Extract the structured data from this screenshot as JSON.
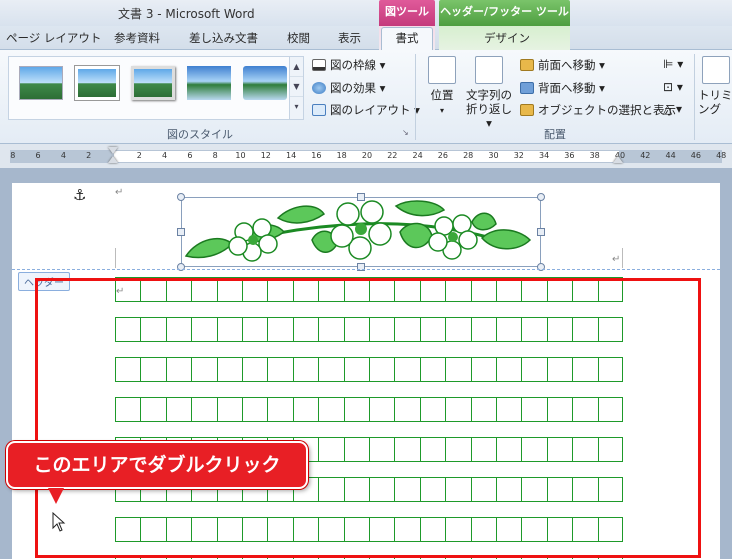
{
  "window": {
    "title": "文書 3 - Microsoft Word"
  },
  "context_tabs": {
    "picture_tools": "図ツール",
    "header_footer_tools": "ヘッダー/フッター ツール"
  },
  "tabs": {
    "page_layout": "ページ レイアウト",
    "references": "参考資料",
    "mailings": "差し込み文書",
    "review": "校閲",
    "view": "表示",
    "format": "書式",
    "design": "デザイン"
  },
  "ribbon": {
    "picture_styles": {
      "label": "図のスタイル",
      "border": "図の枠線",
      "effects": "図の効果",
      "layout": "図のレイアウト"
    },
    "arrange": {
      "label": "配置",
      "position": "位置",
      "wrap_line1": "文字列の",
      "wrap_line2": "折り返し",
      "bring_forward": "前面へ移動",
      "send_backward": "背面へ移動",
      "selection_pane": "オブジェクトの選択と表示"
    },
    "size": {
      "crop": "トリミング"
    }
  },
  "ruler": {
    "left": [
      "8",
      "6",
      "4",
      "2"
    ],
    "right": [
      "2",
      "4",
      "6",
      "8",
      "10",
      "12",
      "14",
      "16",
      "18",
      "20",
      "22",
      "24",
      "26",
      "28",
      "30",
      "32",
      "34",
      "36",
      "38",
      "40",
      "42",
      "44",
      "46",
      "48"
    ]
  },
  "document": {
    "header_label": "ヘッダー",
    "callout": "このエリアでダブルクリック",
    "paragraph_mark": "↵",
    "anchor_symbol": "⚓"
  },
  "colors": {
    "grid_green": "#1e9a2a",
    "callout_red": "#e81f25",
    "highlight_red": "#e11111"
  }
}
